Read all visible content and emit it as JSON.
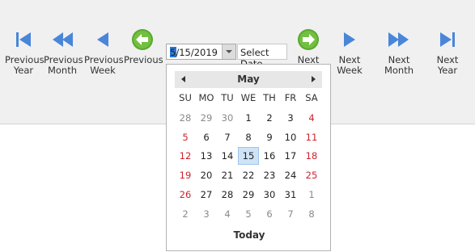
{
  "toolbar": {
    "previous_year": "Previous\nYear",
    "previous_month": "Previous\nMonth",
    "previous_week": "Previous\nWeek",
    "previous": "Previous",
    "next": "Next",
    "next_week": "Next Week",
    "next_month": "Next Month",
    "next_year": "Next Year",
    "accent_blue": "#4a86d8",
    "accent_green": "#5aa832"
  },
  "date_edit": {
    "value": "5/15/2019",
    "first_char_selected": "5"
  },
  "select_date": {
    "label": "Select Date"
  },
  "calendar": {
    "month_label": "May",
    "weekdays": [
      "SU",
      "MO",
      "TU",
      "WE",
      "TH",
      "FR",
      "SA"
    ],
    "weeks": [
      [
        "28",
        "29",
        "30",
        "1",
        "2",
        "3",
        "4"
      ],
      [
        "5",
        "6",
        "7",
        "8",
        "9",
        "10",
        "11"
      ],
      [
        "12",
        "13",
        "14",
        "15",
        "16",
        "17",
        "18"
      ],
      [
        "19",
        "20",
        "21",
        "22",
        "23",
        "24",
        "25"
      ],
      [
        "26",
        "27",
        "28",
        "29",
        "30",
        "31",
        "1"
      ],
      [
        "2",
        "3",
        "4",
        "5",
        "6",
        "7",
        "8"
      ]
    ],
    "selected": "15",
    "today_label": "Today",
    "weekend_color": "#d0222a"
  }
}
